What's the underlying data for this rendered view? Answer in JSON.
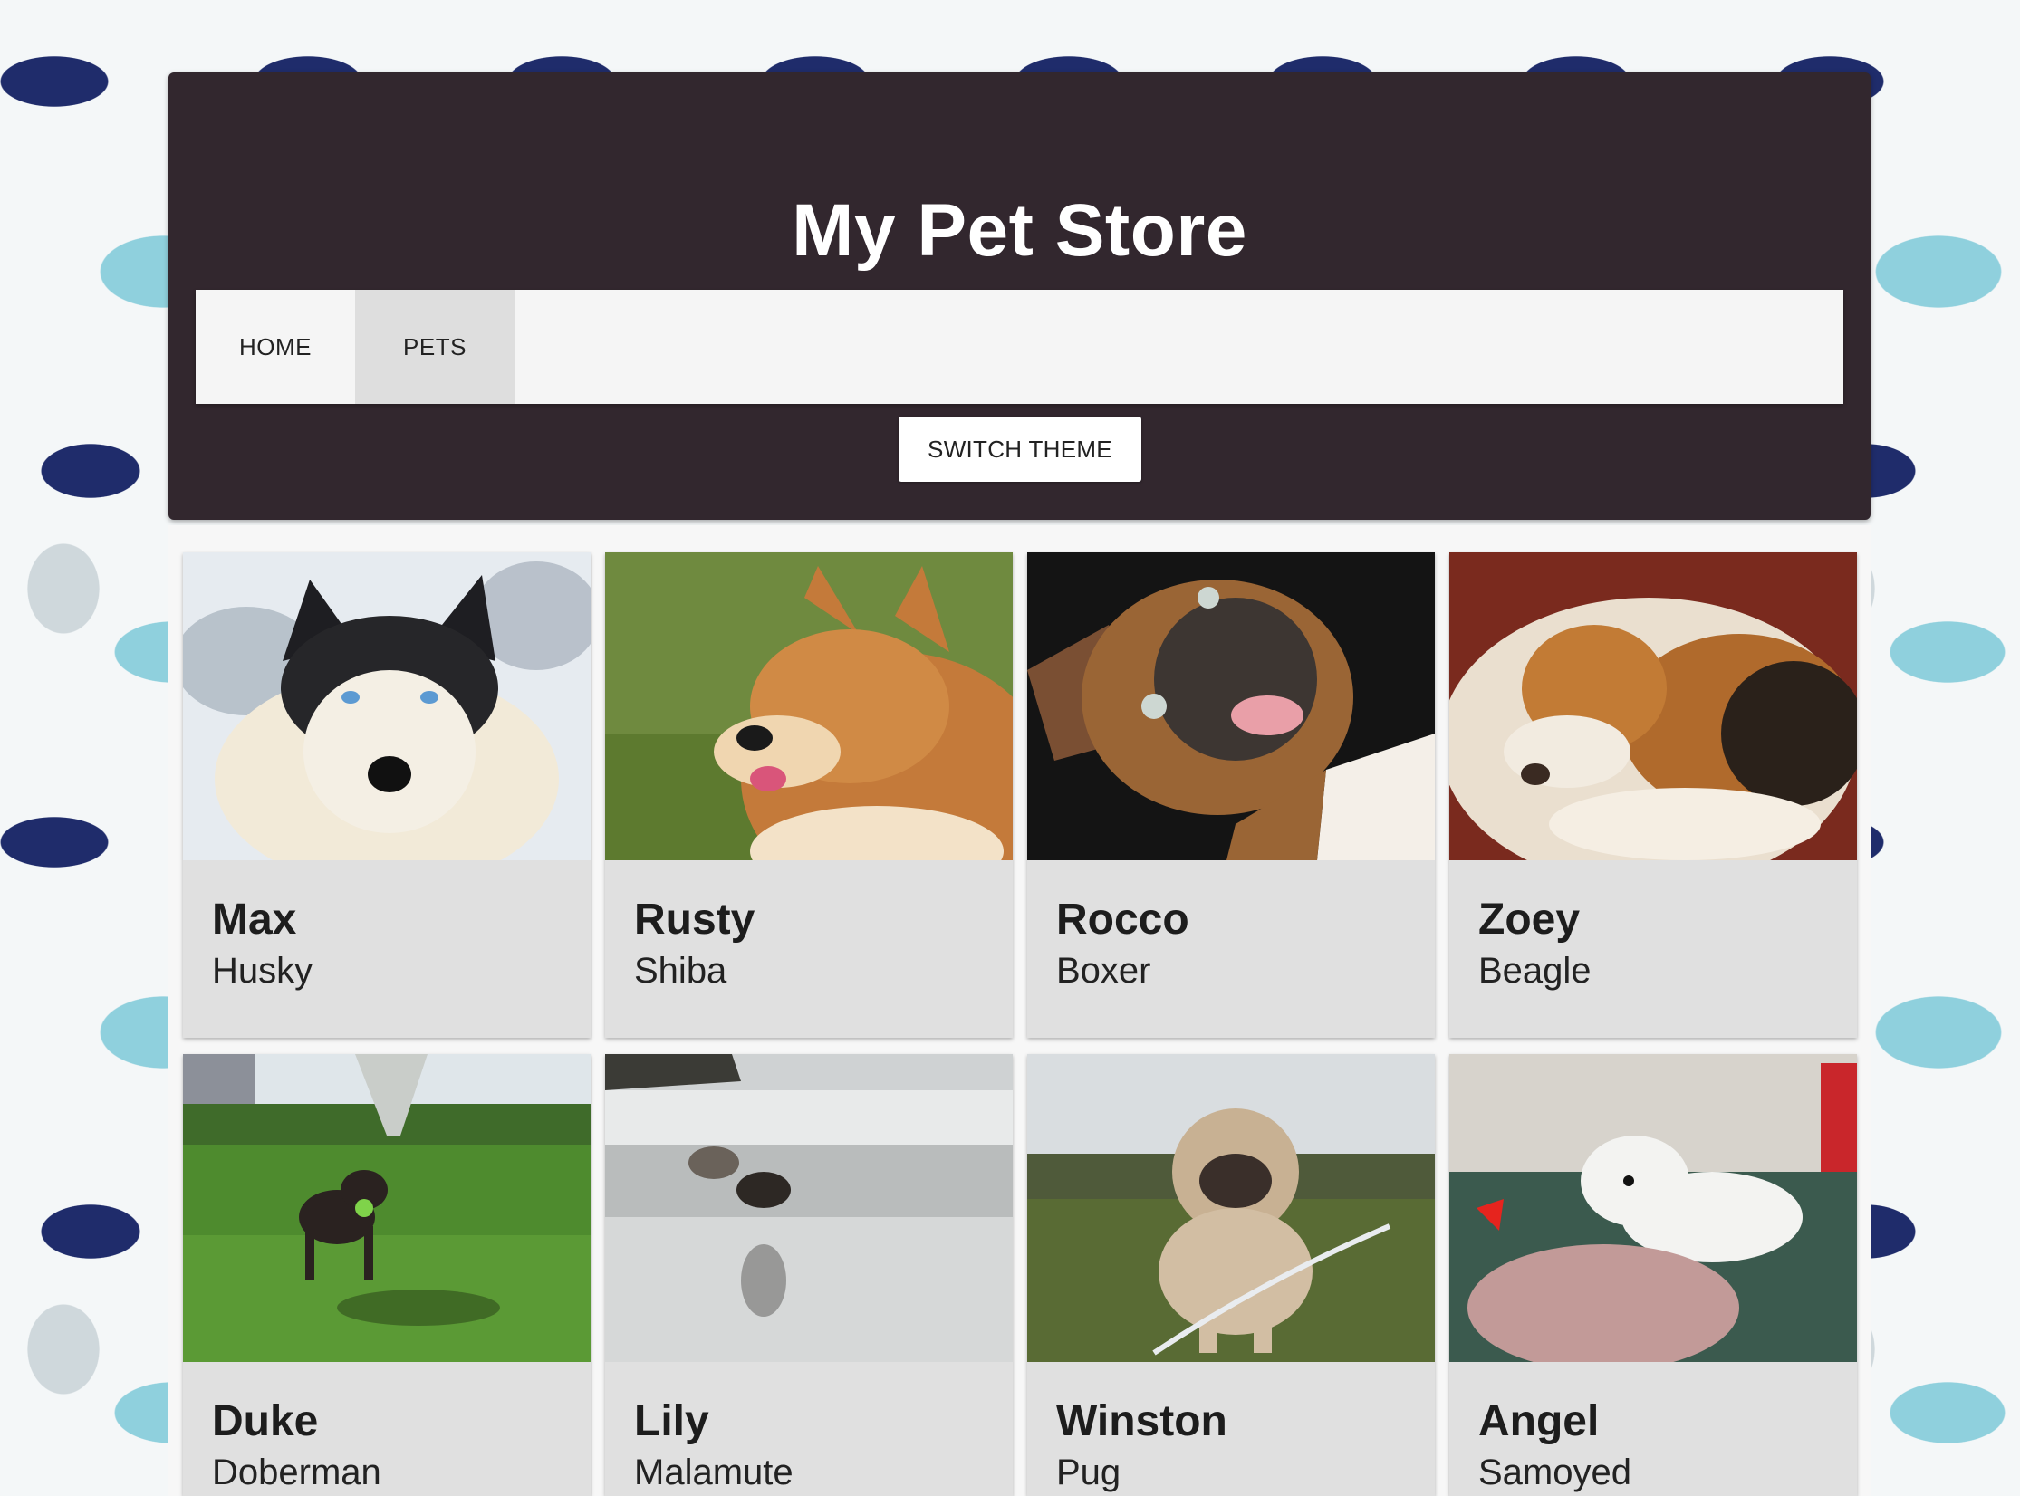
{
  "header": {
    "title": "My Pet Store",
    "switch_theme_label": "SWITCH THEME"
  },
  "nav": {
    "items": [
      {
        "label": "HOME",
        "active": false
      },
      {
        "label": "PETS",
        "active": true
      }
    ]
  },
  "pets": [
    {
      "name": "Max",
      "breed": "Husky",
      "photo": "husky-photo"
    },
    {
      "name": "Rusty",
      "breed": "Shiba",
      "photo": "shiba-photo"
    },
    {
      "name": "Rocco",
      "breed": "Boxer",
      "photo": "boxer-photo"
    },
    {
      "name": "Zoey",
      "breed": "Beagle",
      "photo": "beagle-photo"
    },
    {
      "name": "Duke",
      "breed": "Doberman",
      "photo": "doberman-photo"
    },
    {
      "name": "Lily",
      "breed": "Malamute",
      "photo": "malamute-photo"
    },
    {
      "name": "Winston",
      "breed": "Pug",
      "photo": "pug-photo"
    },
    {
      "name": "Angel",
      "breed": "Samoyed",
      "photo": "samoyed-photo"
    }
  ],
  "colors": {
    "header_bg": "#32272e",
    "nav_bg": "#f5f5f5",
    "nav_active_bg": "#dedede",
    "card_bg": "#e0e0e0",
    "wallpaper_navy": "#1f2c6b",
    "wallpaper_teal": "#8fd0dd"
  }
}
